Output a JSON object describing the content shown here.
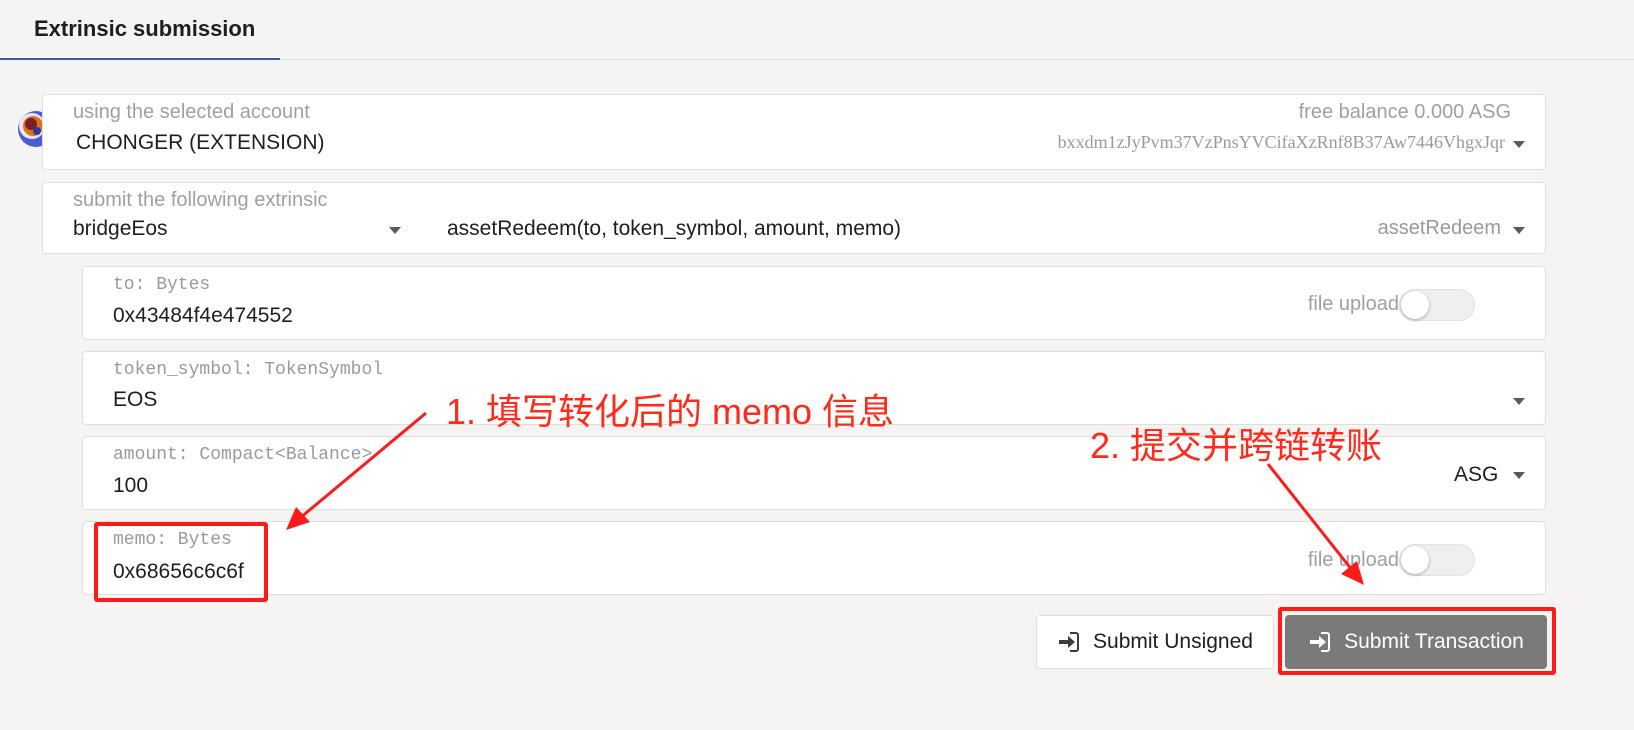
{
  "tab": {
    "label": "Extrinsic submission"
  },
  "account": {
    "label": "using the selected account",
    "name": "CHONGER (EXTENSION)",
    "balance_text": "free balance 0.000 ASG",
    "address": "bxxdm1zJyPvm37VzPnsYVCifaXzRnf8B37Aw7446VhgxJqr"
  },
  "extrinsic": {
    "label": "submit the following extrinsic",
    "module": "bridgeEos",
    "signature": "assetRedeem(to, token_symbol, amount, memo)",
    "method": "assetRedeem"
  },
  "params": {
    "to": {
      "label": "to: Bytes",
      "value": "0x43484f4e474552",
      "file_upload_label": "file upload"
    },
    "token_symbol": {
      "label": "token_symbol: TokenSymbol",
      "value": "EOS"
    },
    "amount": {
      "label": "amount: Compact<Balance>",
      "value": "100",
      "unit": "ASG"
    },
    "memo": {
      "label": "memo: Bytes",
      "value": "0x68656c6c6f",
      "file_upload_label": "file upload"
    }
  },
  "actions": {
    "unsigned_label": "Submit Unsigned",
    "submit_label": "Submit Transaction"
  },
  "annotations": {
    "note1": "1. 填写转化后的 memo 信息",
    "note2": "2. 提交并跨链转账"
  },
  "colors": {
    "accent": "#3a5ba8",
    "annotation_red": "#ff1a1a",
    "submit_bg": "#7a7a7a"
  }
}
